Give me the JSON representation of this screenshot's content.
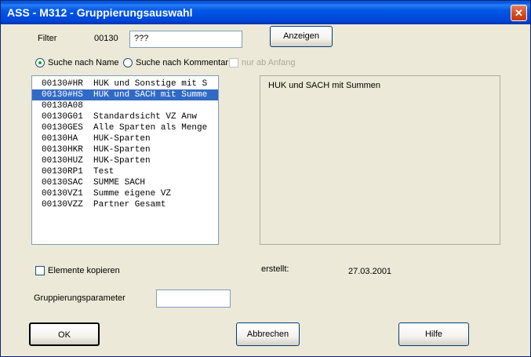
{
  "window": {
    "title": "ASS - M312 - Gruppierungsauswahl"
  },
  "filter": {
    "label": "Filter",
    "code": "00130",
    "value": "???"
  },
  "buttons": {
    "show": "Anzeigen",
    "ok": "OK",
    "cancel": "Abbrechen",
    "help": "Hilfe"
  },
  "search": {
    "by_name": "Suche nach Name",
    "by_comment": "Suche nach Kommentar",
    "from_start": "nur ab Anfang",
    "selected": "by_name"
  },
  "list": {
    "items": [
      {
        "code": "00130#HR",
        "name": "HUK und Sonstige mit S"
      },
      {
        "code": "00130#HS",
        "name": "HUK und SACH mit Summe"
      },
      {
        "code": "00130A08",
        "name": ""
      },
      {
        "code": "00130G01",
        "name": "Standardsicht VZ Anw"
      },
      {
        "code": "00130GES",
        "name": "Alle Sparten als Menge"
      },
      {
        "code": "00130HA",
        "name": "HUK-Sparten"
      },
      {
        "code": "00130HKR",
        "name": "HUK-Sparten"
      },
      {
        "code": "00130HUZ",
        "name": "HUK-Sparten"
      },
      {
        "code": "00130RP1",
        "name": "Test"
      },
      {
        "code": "00130SAC",
        "name": "SUMME SACH"
      },
      {
        "code": "00130VZ1",
        "name": "Summe eigene VZ"
      },
      {
        "code": "00130VZZ",
        "name": "Partner Gesamt"
      }
    ],
    "selected_index": 1
  },
  "description": "HUK und SACH mit Summen",
  "copy_elements": {
    "label": "Elemente kopieren",
    "checked": false
  },
  "created": {
    "label": "erstellt:",
    "date": "27.03.2001"
  },
  "param": {
    "label": "Gruppierungsparameter",
    "value": ""
  }
}
